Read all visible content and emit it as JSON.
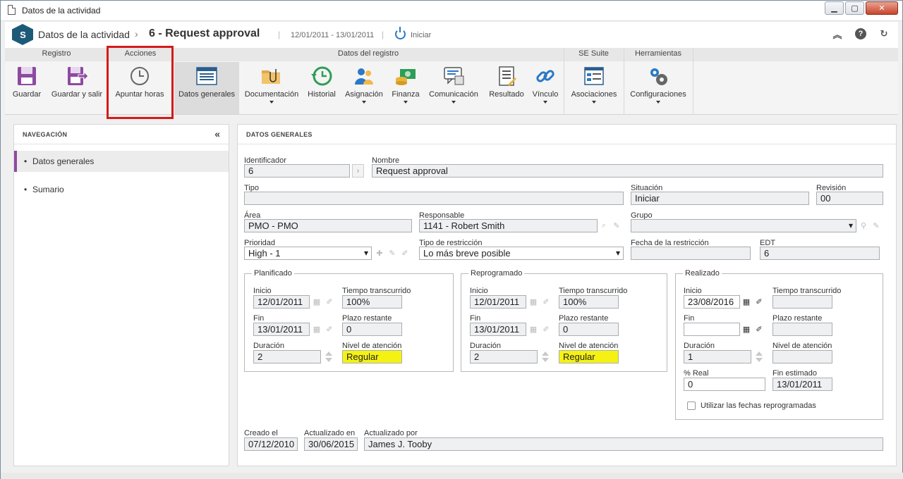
{
  "window": {
    "title": "Datos de la actividad"
  },
  "header": {
    "logo_text": "S",
    "section": "Datos de la actividad",
    "record_title": "6 - Request approval",
    "dates": "12/01/2011 - 13/01/2011",
    "status": "Iniciar"
  },
  "ribbon": {
    "groups": {
      "registro": "Registro",
      "acciones": "Acciones",
      "datos_registro": "Datos del registro",
      "se_suite": "SE Suite",
      "herramientas": "Herramientas"
    },
    "buttons": {
      "guardar": "Guardar",
      "guardar_salir": "Guardar y salir",
      "apuntar_horas": "Apuntar horas",
      "datos_generales": "Datos generales",
      "documentacion": "Documentación",
      "historial": "Historial",
      "asignacion": "Asignación",
      "finanza": "Finanza",
      "comunicacion": "Comunicación",
      "resultado": "Resultado",
      "vinculo": "Vínculo",
      "asociaciones": "Asociaciones",
      "configuraciones": "Configuraciones"
    }
  },
  "nav": {
    "title": "NAVEGACIÓN",
    "items": [
      "Datos generales",
      "Sumario"
    ]
  },
  "main": {
    "title": "DATOS GENERALES",
    "identificador": {
      "label": "Identificador",
      "value": "6"
    },
    "nombre": {
      "label": "Nombre",
      "value": "Request approval"
    },
    "tipo": {
      "label": "Tipo",
      "value": ""
    },
    "situacion": {
      "label": "Situación",
      "value": "Iniciar"
    },
    "revision": {
      "label": "Revisión",
      "value": "00"
    },
    "area": {
      "label": "Área",
      "value": "PMO - PMO"
    },
    "responsable": {
      "label": "Responsable",
      "value": "1141 - Robert Smith"
    },
    "grupo": {
      "label": "Grupo",
      "value": ""
    },
    "prioridad": {
      "label": "Prioridad",
      "value": "High - 1"
    },
    "tipo_restriccion": {
      "label": "Tipo de restricción",
      "value": "Lo más breve posible"
    },
    "fecha_restriccion": {
      "label": "Fecha de la restricción",
      "value": ""
    },
    "edt": {
      "label": "EDT",
      "value": "6"
    },
    "planificado": {
      "title": "Planificado",
      "inicio_label": "Inicio",
      "inicio": "12/01/2011",
      "tiempo_label": "Tiempo transcurrido",
      "tiempo": "100%",
      "fin_label": "Fin",
      "fin": "13/01/2011",
      "plazo_label": "Plazo restante",
      "plazo": "0",
      "duracion_label": "Duración",
      "duracion": "2",
      "nivel_label": "Nivel de atención",
      "nivel": "Regular"
    },
    "reprogramado": {
      "title": "Reprogramado",
      "inicio_label": "Inicio",
      "inicio": "12/01/2011",
      "tiempo_label": "Tiempo transcurrido",
      "tiempo": "100%",
      "fin_label": "Fin",
      "fin": "13/01/2011",
      "plazo_label": "Plazo restante",
      "plazo": "0",
      "duracion_label": "Duración",
      "duracion": "2",
      "nivel_label": "Nivel de atención",
      "nivel": "Regular"
    },
    "realizado": {
      "title": "Realizado",
      "inicio_label": "Inicio",
      "inicio": "23/08/2016",
      "tiempo_label": "Tiempo transcurrido",
      "tiempo": "",
      "fin_label": "Fin",
      "fin": "",
      "plazo_label": "Plazo restante",
      "plazo": "",
      "duracion_label": "Duración",
      "duracion": "1",
      "nivel_label": "Nivel de atención",
      "nivel": "",
      "real_label": "% Real",
      "real": "0",
      "fin_estimado_label": "Fin estimado",
      "fin_estimado": "13/01/2011",
      "checkbox_label": "Utilizar las fechas reprogramadas"
    },
    "creado": {
      "label": "Creado el",
      "value": "07/12/2010"
    },
    "actualizado_en": {
      "label": "Actualizado en",
      "value": "30/06/2015"
    },
    "actualizado_por": {
      "label": "Actualizado por",
      "value": "James J. Tooby"
    }
  },
  "colors": {
    "accent": "#8e4aa0",
    "highlight": "#d61a1a",
    "yellow": "#f5f213",
    "logo": "#1d5a78"
  }
}
